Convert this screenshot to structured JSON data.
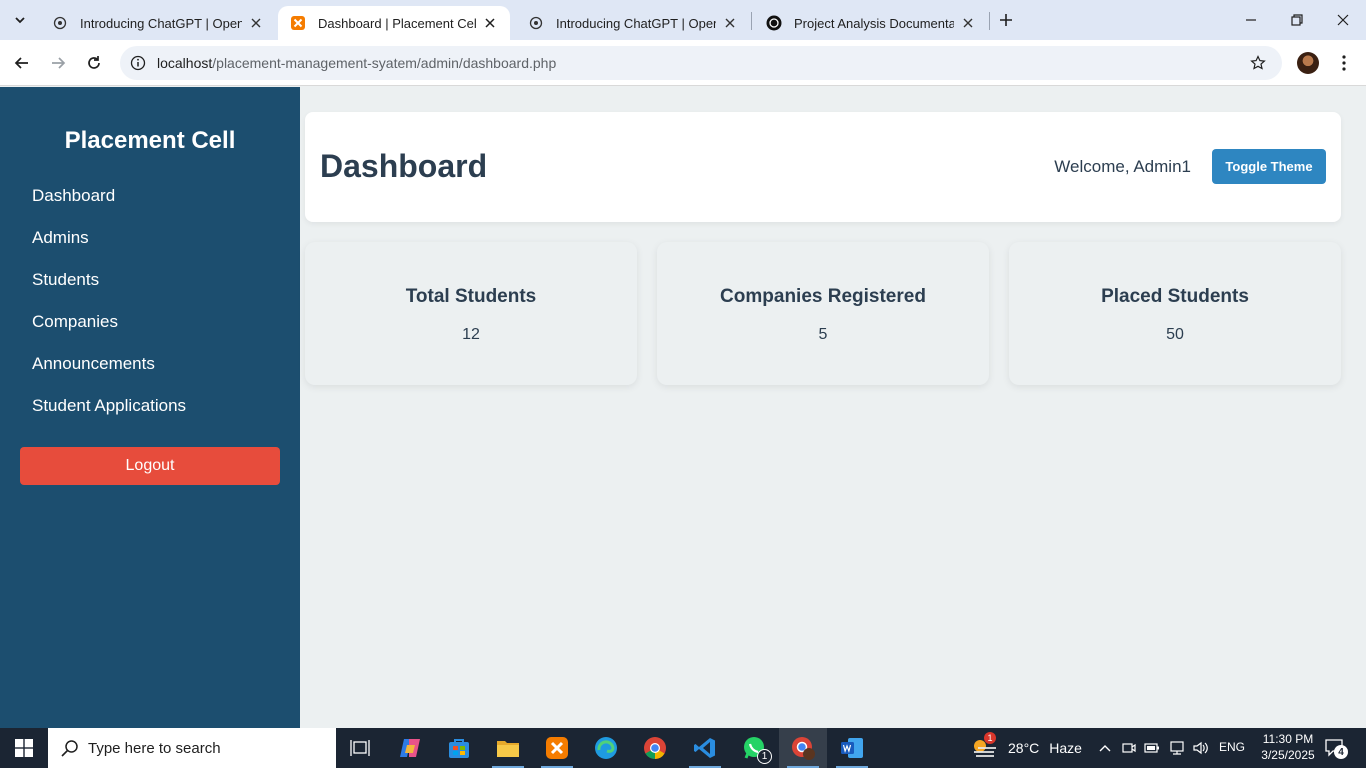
{
  "browser": {
    "tabs": [
      {
        "title": "Introducing ChatGPT | OpenAI",
        "active": false
      },
      {
        "title": "Dashboard | Placement Cell Dashboard",
        "active": true
      },
      {
        "title": "Introducing ChatGPT | OpenAI",
        "active": false
      },
      {
        "title": "Project Analysis Documentation",
        "active": false
      }
    ],
    "url_host": "localhost",
    "url_path": "/placement-management-syatem/admin/dashboard.php"
  },
  "sidebar": {
    "brand": "Placement Cell",
    "items": [
      {
        "label": "Dashboard"
      },
      {
        "label": "Admins"
      },
      {
        "label": "Students"
      },
      {
        "label": "Companies"
      },
      {
        "label": "Announcements"
      },
      {
        "label": "Student Applications"
      }
    ],
    "logout_label": "Logout"
  },
  "header": {
    "title": "Dashboard",
    "welcome": "Welcome, Admin1",
    "toggle_label": "Toggle Theme"
  },
  "stats": [
    {
      "label": "Total Students",
      "value": "12"
    },
    {
      "label": "Companies Registered",
      "value": "5"
    },
    {
      "label": "Placed Students",
      "value": "50"
    }
  ],
  "taskbar": {
    "search_placeholder": "Type here to search",
    "weather_temp": "28°C",
    "weather_desc": "Haze",
    "weather_badge": "1",
    "whatsapp_badge": "1",
    "language": "ENG",
    "time": "11:30 PM",
    "date": "3/25/2025",
    "notifications": "4"
  },
  "colors": {
    "sidebar": "#1c4e6f",
    "logout": "#e74c3c",
    "toggle": "#2e86c1",
    "text": "#2c3e50",
    "background": "#ecf0f1"
  }
}
